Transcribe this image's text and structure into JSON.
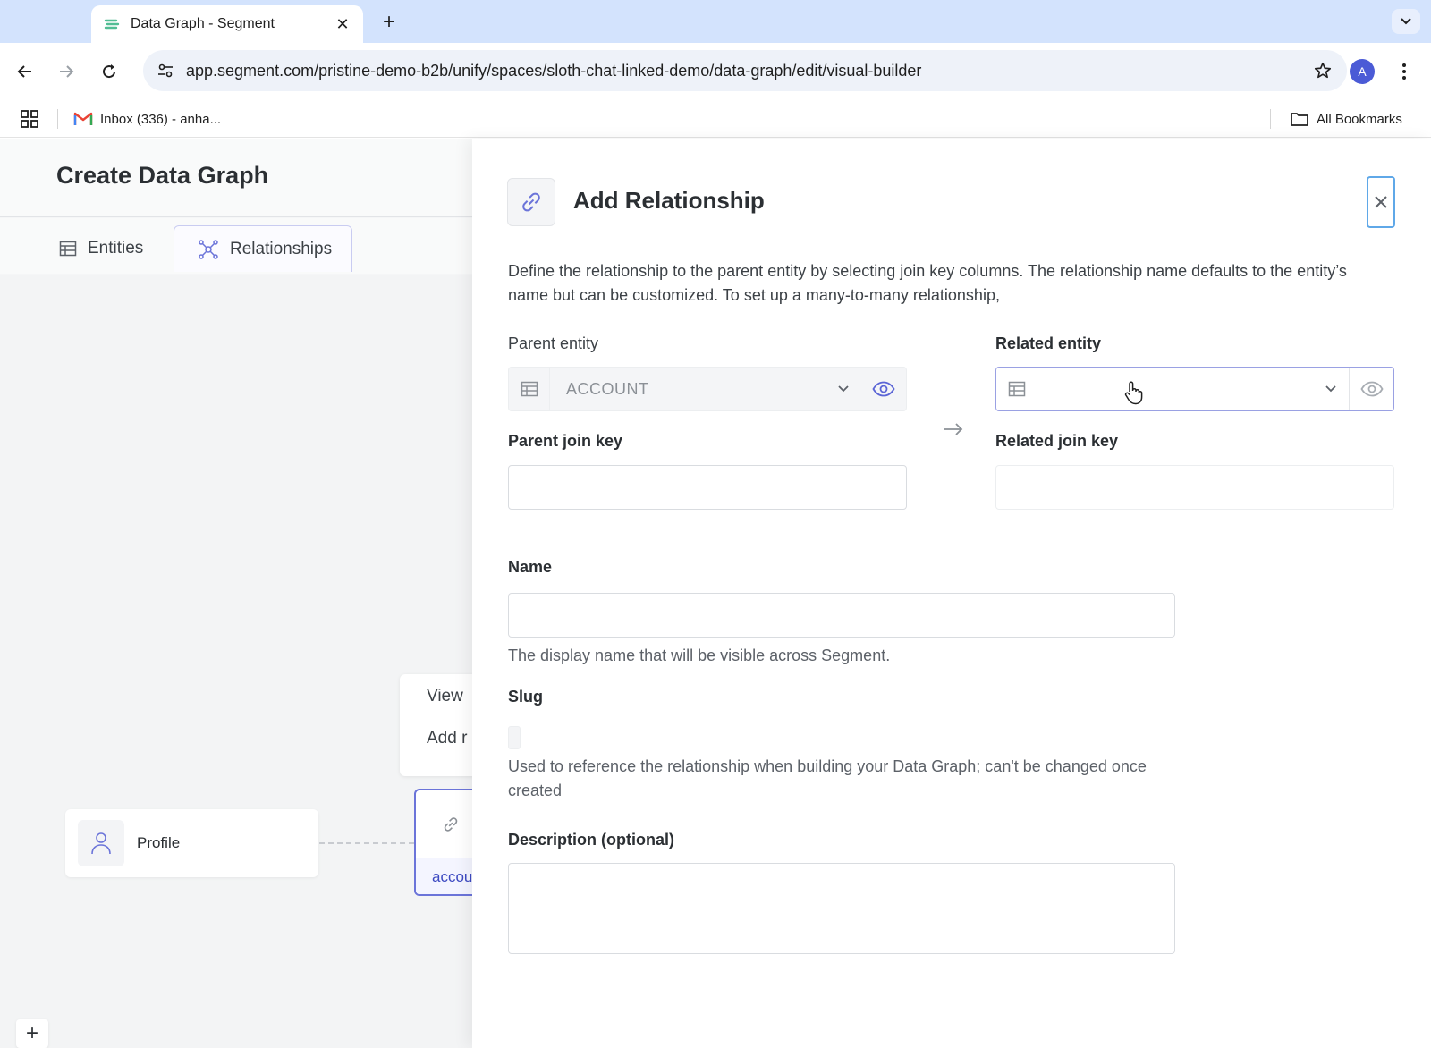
{
  "browser": {
    "tab_title": "Data Graph - Segment",
    "url": "app.segment.com/pristine-demo-b2b/unify/spaces/sloth-chat-linked-demo/data-graph/edit/visual-builder",
    "avatar_letter": "A",
    "bookmark_inbox": "Inbox (336) - anha...",
    "all_bookmarks": "All Bookmarks"
  },
  "page": {
    "title": "Create Data Graph",
    "tabs": [
      {
        "label": "Entities",
        "active": false
      },
      {
        "label": "Relationships",
        "active": true
      }
    ]
  },
  "canvas": {
    "context_menu": [
      "View",
      "Add r"
    ],
    "profile_node_label": "Profile",
    "account_node_label": "accou"
  },
  "panel": {
    "title": "Add Relationship",
    "description": "Define the relationship to the parent entity by selecting join key columns. The relationship name defaults to the entity’s name but can be customized. To set up a many-to-many relationship,",
    "parent_entity": {
      "label": "Parent entity",
      "value": "ACCOUNT"
    },
    "related_entity": {
      "label": "Related entity",
      "value": ""
    },
    "parent_join_key": {
      "label": "Parent join key",
      "value": ""
    },
    "related_join_key": {
      "label": "Related join key",
      "value": ""
    },
    "name": {
      "label": "Name",
      "value": "",
      "help": "The display name that will be visible across Segment."
    },
    "slug": {
      "label": "Slug",
      "help": "Used to reference the relationship when building your Data Graph; can't be changed once created"
    },
    "description_field": {
      "label": "Description (optional)",
      "value": ""
    }
  },
  "colors": {
    "accent": "#5b65d6",
    "close_focus": "#5fa8e8",
    "browser_chrome": "#d3e3fd"
  },
  "icons": [
    "segment-favicon",
    "close-icon",
    "plus-icon",
    "chevron-down-icon",
    "back-arrow-icon",
    "forward-arrow-icon",
    "reload-icon",
    "tune-icon",
    "star-icon",
    "more-vert-icon",
    "apps-grid-icon",
    "gmail-icon",
    "folder-icon",
    "table-icon",
    "network-icon",
    "link-icon",
    "user-icon",
    "eye-icon",
    "arrow-right-icon",
    "hand-cursor-icon"
  ]
}
